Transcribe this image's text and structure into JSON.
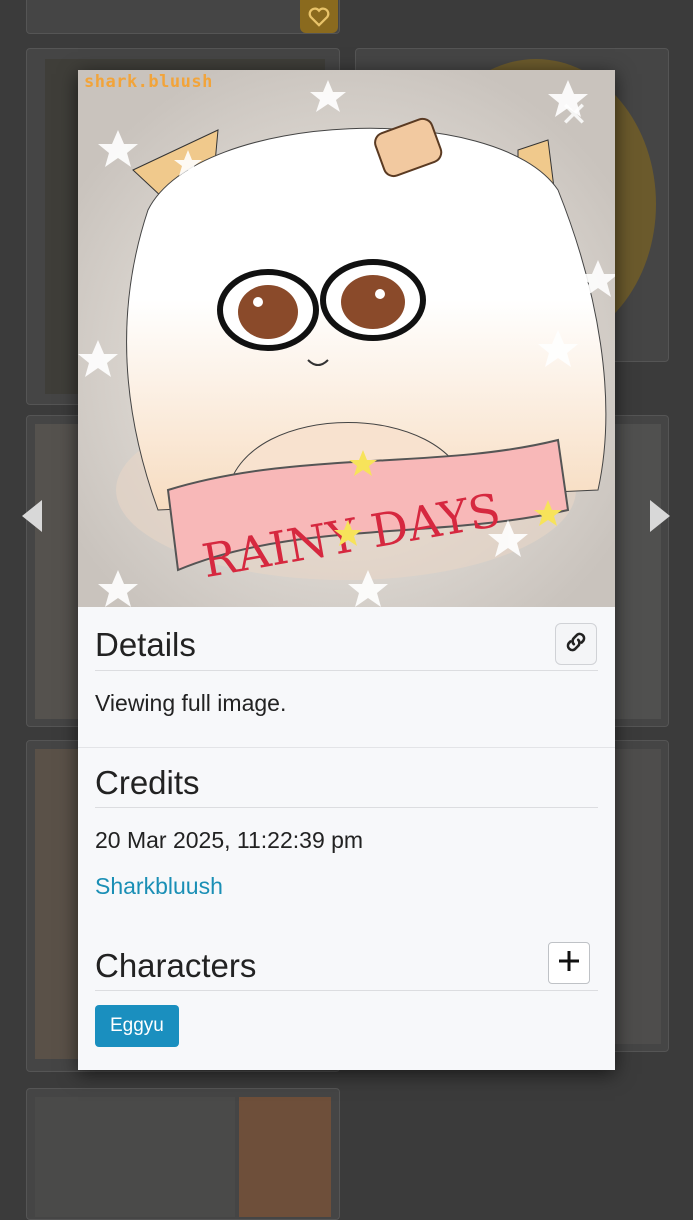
{
  "gallery": {
    "prev_label": "Previous image",
    "next_label": "Next image"
  },
  "artwork": {
    "signature": "shark.bluush",
    "banner_text": "RAINY DAYS"
  },
  "details": {
    "title": "Details",
    "text": "Viewing full image."
  },
  "credits": {
    "title": "Credits",
    "timestamp": "20 Mar 2025, 11:22:39 pm",
    "artist": "Sharkbluush"
  },
  "characters": {
    "title": "Characters",
    "tags": [
      "Eggyu"
    ]
  },
  "colors": {
    "accent": "#1a8fbf",
    "link": "#1a8fb5",
    "backdrop": "#3b3b3b",
    "panel": "#f7f8fa"
  }
}
